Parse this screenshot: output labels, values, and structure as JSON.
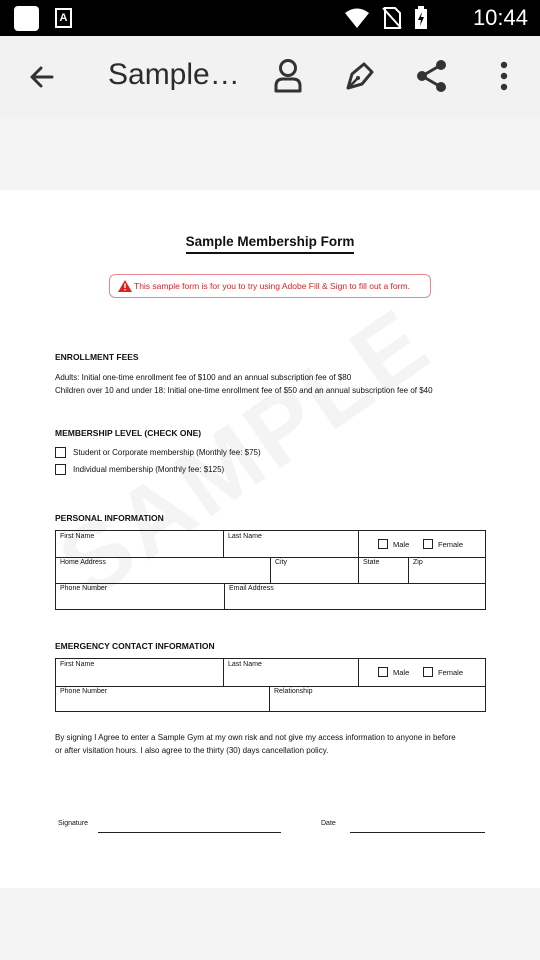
{
  "status_bar": {
    "time": "10:44",
    "notif_icon_letter": "A"
  },
  "app_bar": {
    "title": "Sample…",
    "icons": [
      "back-arrow-icon",
      "person-icon",
      "pen-nib-icon",
      "share-icon",
      "more-vert-icon"
    ]
  },
  "form": {
    "title": "Sample Membership Form",
    "notice": "This sample form is for you to try using Adobe Fill & Sign to fill out a form.",
    "watermark": "SAMPLE",
    "enrollment": {
      "heading": "ENROLLMENT FEES",
      "line1": "Adults: Initial one-time enrollment fee of $100 and an annual subscription fee of $80",
      "line2": "Children over 10 and under 18: Initial one-time enrollment fee of $50 and an annual subscription fee of $40"
    },
    "membership": {
      "heading": "MEMBERSHIP LEVEL (CHECK ONE)",
      "option1": "Student or Corporate membership (Monthly fee: $75)",
      "option2": "Individual membership (Monthly fee: $125)"
    },
    "personal": {
      "heading": "PERSONAL INFORMATION",
      "first_name": "First Name",
      "last_name": "Last Name",
      "male": "Male",
      "female": "Female",
      "home_address": "Home Address",
      "city": "City",
      "state": "State",
      "zip": "Zip",
      "phone": "Phone Number",
      "email": "Email Address"
    },
    "emergency": {
      "heading": "EMERGENCY CONTACT INFORMATION",
      "first_name": "First Name",
      "last_name": "Last Name",
      "male": "Male",
      "female": "Female",
      "phone": "Phone Number",
      "relationship": "Relationship"
    },
    "agreement": {
      "line1": "By signing I Agree to enter a Sample Gym at my own risk and not give my access information to anyone in before",
      "line2": "or after visitation hours. I also agree to the thirty (30) days cancellation policy."
    },
    "signature_label": "Signature",
    "date_label": "Date"
  },
  "colors": {
    "status_bar": "#000000",
    "app_bar": "#f2f2f2",
    "notice_red": "#e0201f"
  }
}
